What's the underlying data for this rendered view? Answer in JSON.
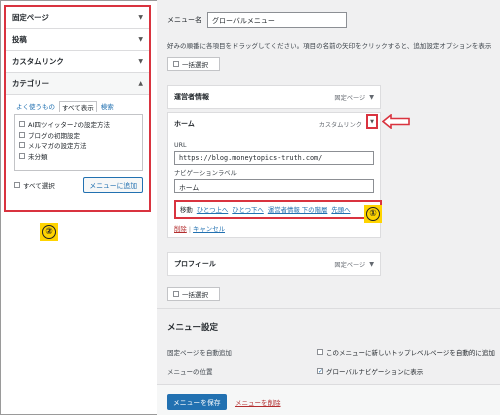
{
  "left": {
    "sections": [
      "固定ページ",
      "投稿",
      "カスタムリンク"
    ],
    "category": {
      "title": "カテゴリー",
      "tabs": [
        "よく使うもの",
        "すべて表示",
        "検索"
      ],
      "items": [
        "AI四ツイッター♪の設定方法",
        "ブログの初期設定",
        "メルマガの設定方法",
        "未分類"
      ],
      "select_all": "すべて選択",
      "add_button": "メニューに追加"
    }
  },
  "badges": {
    "left": "②",
    "right": "①"
  },
  "menu": {
    "name_label": "メニュー名",
    "name_value": "グローバルメニュー",
    "instructions": "好みの順番に各項目をドラッグしてください。項目の名前の矢印をクリックすると、追加設定オプションを表示",
    "bulk_select": "一括選択",
    "items": [
      {
        "title": "運営者情報",
        "type": "固定ページ"
      },
      {
        "title": "ホーム",
        "type": "カスタムリンク",
        "url_label": "URL",
        "url_value": "https://blog.moneytopics-truth.com/",
        "nav_label": "ナビゲーションラベル",
        "nav_value": "ホーム",
        "move_label": "移動",
        "move_links": [
          "ひとつ上へ",
          "ひとつ下へ",
          "運営者情報 下の階層",
          "先頭へ"
        ],
        "delete": "削除",
        "separator": "|",
        "cancel": "キャンセル"
      },
      {
        "title": "プロフィール",
        "type": "固定ページ"
      }
    ]
  },
  "settings": {
    "title": "メニュー設定",
    "auto_add_label": "固定ページを自動追加",
    "auto_add_text": "このメニューに新しいトップレベルページを自動的に追加",
    "location_label": "メニューの位置",
    "location_text": "グローバルナビゲーションに表示"
  },
  "footer": {
    "save": "メニューを保存",
    "delete_menu": "メニューを削除"
  },
  "colors": {
    "highlight": "#d9333f",
    "badge": "#ffd400",
    "primary": "#2271b1"
  },
  "icons": {
    "expand": "triangle-down-icon",
    "collapse": "triangle-up-icon"
  }
}
